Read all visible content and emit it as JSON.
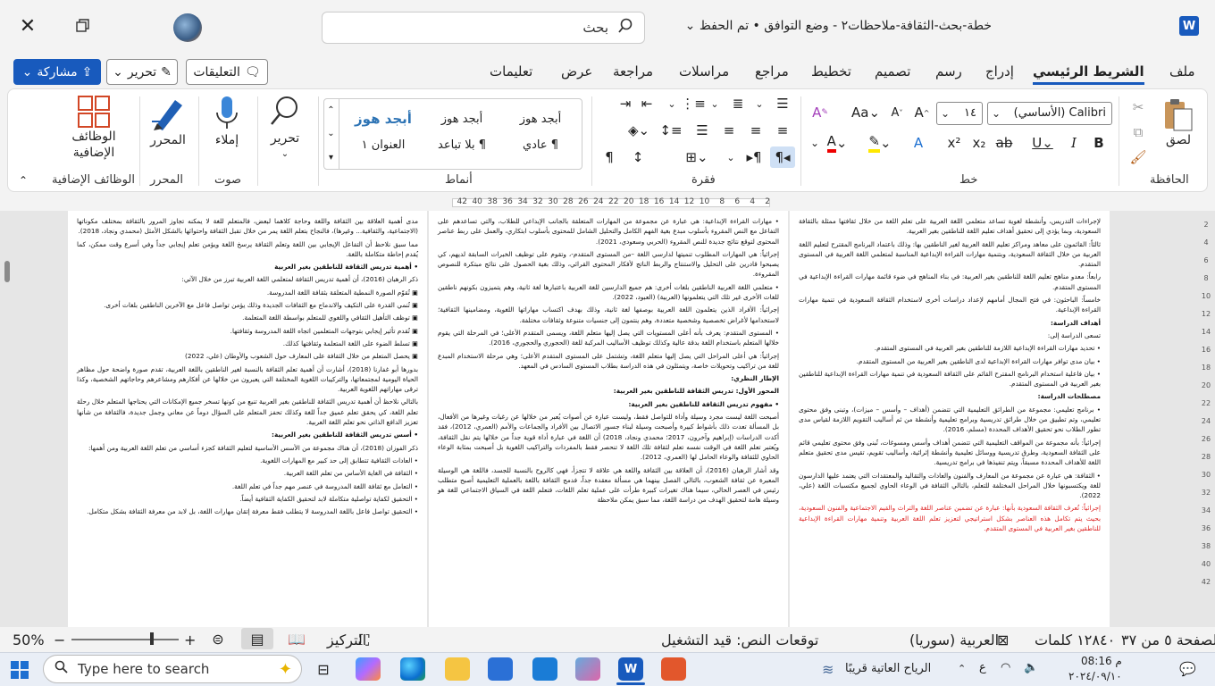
{
  "titlebar": {
    "app_icon": "word-icon",
    "doc_title": "خطة-بحث-الثقافة-ملاحظات٢ - وضع التوافق • تم الحفظ",
    "search_placeholder": "بحث"
  },
  "tabs": [
    "ملف",
    "الشريط الرئيسي",
    "إدراج",
    "رسم",
    "تصميم",
    "تخطيط",
    "مراجع",
    "مراسلات",
    "مراجعة",
    "عرض",
    "تعليمات"
  ],
  "active_tab": "الشريط الرئيسي",
  "top_buttons": {
    "comments": "التعليقات",
    "edit": "تحرير",
    "share": "مشاركة"
  },
  "ribbon": {
    "clipboard": {
      "label": "الحافظة",
      "paste": "لصق"
    },
    "font": {
      "label": "خط",
      "font_name": "Calibri (الأساسي)",
      "font_size": "١٤",
      "bold": "B",
      "italic": "I",
      "underline": "U",
      "strike": "ab",
      "sub": "x₂",
      "sup": "x²",
      "case": "Aa"
    },
    "paragraph": {
      "label": "فقرة"
    },
    "styles": {
      "label": "أنماط",
      "items": [
        {
          "sample": "أبجد هوز",
          "name": "¶ عادي"
        },
        {
          "sample": "أبجد هوز",
          "name": "¶ بلا تباعد"
        },
        {
          "sample": "أبجد هوز",
          "name": "العنوان ١"
        }
      ]
    },
    "editing": {
      "label": "تحرير"
    },
    "voice": {
      "label": "صوت",
      "dictate": "إملاء"
    },
    "editor": {
      "label": "المحرر",
      "btn": "المحرر"
    },
    "addins": {
      "label": "الوظائف الإضافية",
      "btn1": "الوظائف",
      "btn2": "الإضافية"
    }
  },
  "ruler": [
    "2",
    "4",
    "6",
    "8",
    "10",
    "12",
    "14",
    "16",
    "18",
    "20",
    "22",
    "24",
    "26",
    "28",
    "30",
    "32",
    "34",
    "36",
    "38",
    "40",
    "42"
  ],
  "pages": {
    "right": [
      {
        "t": "لإجراءات التدريس، وأنشطة لغوية تساعد متعلمي اللغة العربية على تعلم اللغة من خلال ثقافتها ممثلة بالثقافة السعودية، وبما يؤدي إلى تحقيق أهداف تعليم اللغة للناطقين بغير العربية."
      },
      {
        "t": "ثالثاً: القائمون على معاهد ومراكز تعليم اللغة العربية لغير الناطقين بها: وذلك باعتماد البرنامج المقترح لتعليم اللغة العربية من خلال الثقافة السعودية، وبتنمية مهارات القراءة الإبداعية المناسبة لمتعلمي اللغة العربية في المستوى المتقدم."
      },
      {
        "t": "رابعاً: معدو مناهج تعليم اللغة للناطقين بغير العربية: في بناء المناهج في ضوء قائمة مهارات القراءة الإبداعية في المستوى المتقدم."
      },
      {
        "t": "خامساً: الباحثون: في فتح المجال أمامهم لإعداد دراسات أخرى لاستخدام الثقافة السعودية في تنمية مهارات القراءة الإبداعية."
      },
      {
        "t": "أهداف الدراسة:",
        "h": true
      },
      {
        "t": "تسعى الدراسة إلى:"
      },
      {
        "t": "• تحديد مهارات القراءة الإبداعية اللازمة للناطقين بغير العربية في المستوى المتقدم."
      },
      {
        "t": "• بيان مدى توافر مهارات القراءة الإبداعية لدى الناطقين بغير العربية من المستوى المتقدم."
      },
      {
        "t": "• بيان فاعلية استخدام البرنامج المقترح القائم على الثقافة السعودية في تنمية مهارات القراءة الإبداعية للناطقين بغير العربية في المستوى المتقدم."
      },
      {
        "t": "مصطلحات الدراسة:",
        "h": true
      },
      {
        "t": "• برنامج تعليمي: مجموعة من الطرائق التعليمية التي تتضمن (أهداف – وأسس – ميزات)، وتبنى وفق محتوى تعليمي، وتم تطبيق من خلال طرائق تدريسية وبرامج تعليمية وأنشطة من ثم أساليب التقويم اللازمة لقياس مدى تطور الطلاب نحو تحقيق الأهداف المحددة (مسلم، 2016)."
      },
      {
        "t": "إجرائياً: بأنه مجموعة من المواقف التعليمية التي تتضمن أهداف وأسس ومسوغات، تُبنى وفق محتوى تعليمي قائم على الثقافة السعودية، وطرق تدريسية ووسائل تعليمية وأنشطة إثرائية، وأساليب تقويم، تقيس مدى تحقيق متعلم اللغة للأهداف المحددة مسبقاً، ويتم تنفيذها في برامج تدريسية."
      },
      {
        "t": "• الثقافة: هي عبارة عن مجموعة من المعارف والفنون والعادات والتقاليد والمعتقدات التي يعتمد عليها الدارسون للغة ويكتسبونها خلال المراحل المختلفة للتعلم، بالتالي الثقافة في الوعاء الحاوي لجميع مكتسبات اللغة (علي، 2022)."
      },
      {
        "t": "إجرائياً: تُعرف الثقافة السعودية بأنها: عبارة عن تضمين عناصر اللغة والتراث والقيم الاجتماعية والفنون السعودية، بحيث يتم تكامل هذه العناصر بشكل استراتيجي لتعزيز تعلم اللغة العربية وتنمية مهارات القراءة الإبداعية للناطقين بغير العربية في المستوى المتقدم.",
        "red": true
      }
    ],
    "middle": [
      {
        "t": "• مهارات القراءة الإبداعية: هي عبارة عن مجموعة من المهارات المتعلقة بالجانب الإبداعي للطلاب، والتي تساعدهم على التفاعل مع النص المقروء بأسلوب مبدع بغية الفهم الكامل والتحليل الشامل للمحتوى بأسلوب ابتكاري، والعمل على ربط عناصر المحتوى لتوقع نتائج جديدة للنص المقروء (الحربي وسعودي، 2021)."
      },
      {
        "t": "إجرائياً: هي المهارات المطلوب تنميتها لدارسي اللغة –من المستوى المتقدم-، وتقوم على توظيف الخبرات السابقة لديهم، كي يصبحوا قادرين على التحليل والاستنتاج والربط الناتج لأفكار المحتوى القرائي، وذلك بغية الحصول على نتائج مبتكرة للنصوص المقروءة."
      },
      {
        "t": "• متعلمي اللغة العربية الناطقين بلغات أخرى: هم جميع الدارسين للغة العربية باعتبارها لغة ثانية، وهم يتميزون بكونهم ناطقين للغات الأخرى غير تلك التي يتعلمونها (العربية) (العبود، 2022)."
      },
      {
        "t": "إجرائياً: الأفراد الذين يتعلمون اللغة العربية بوصفها لغة ثانية، وذلك بهدف اكتساب مهاراتها اللغوية، ومضامينها الثقافية؛ لاستخدامها لأغراض تخصصية وشخصية متعددة، وهم ينتمون إلى جنسيات متنوعة وثقافات مختلفة."
      },
      {
        "t": "• المستوى المتقدم: يعرف بأنه أعلى المستويات التي يصل إليها متعلم اللغة، ويسمى المتقدم الأعلى؛ في المرحلة التي يقوم خلالها المتعلم باستخدام اللغة بدقة عالية وكذلك توظيف الأساليب المركبة للغة (الحجوري والحجوري، 2016)."
      },
      {
        "t": "إجرائياً: هي أعلى المراحل التي يصل إليها متعلم اللغة، وتشتمل على المستوى المتقدم الأعلى؛ وهي مرحلة الاستخدام المبدع للغة من تراكيب وتحويلات خاصة، ويتمثلون في هذه الدراسة بطلاب المستوى السادس في المعهد."
      },
      {
        "t": "الإطار النظري:",
        "h": true
      },
      {
        "t": "المحور الأول: تدريس الثقافة للناطقين بغير العربية:",
        "h": true
      },
      {
        "t": "• مفهوم تدريس الثقافة للناطقين بغير العربية:",
        "h": true
      },
      {
        "t": "أصبحت اللغة ليست مجرد وسيلة وأداة للتواصل فقط، وليست عبارة عن أصوات يُعبر من خلالها عن رغبات وغيرها من الأفعال، بل المسألة تعدت ذلك بأشواط كبيرة وأصبحت وسيلة لبناء جسور الاتصال بين الأفراد والجماعات والأمم (العمري، 2012)، فقد أكدت الدراسات (إبراهيم وآخرون، 2017؛ محمدي ونجاد، 2018) أن اللغة في عبارة أداة قوية جداً من خلالها يتم نقل الثقافة، ويُعتبر تعلم اللغة في الوقت نفسه تعلم لثقافة تلك اللغة لا تنحصر فقط بالمفردات والتراكيب اللغوية بل أصبحت بمثابة الوعاء الحاوي للثقافة والوعاء الحامل لها (العمري، 2012)."
      },
      {
        "t": "وقد أشار الرهبان (2016)، أن العلاقة بين الثقافة واللغة هي علاقة لا تتجزأ، فهي كالروح بالنسبة للجسد، فاللغة هي الوسيلة المعبرة عن ثقافة الشعوب، بالتالي الفصل بينهما هي مسألة معقدة جداً، فدمج الثقافة باللغة بالعملية التعليمية أصبح متطلب رئيس في العصر الحالي، سيما هناك تغيرات كبيرة طرأت على عملية تعلم اللغات، فتعلم اللغة في السياق الاجتماعي للغة هو وسيلة هامة لتحقيق الهدف من دراسة اللغة، مما سبق يمكن ملاحظة"
      }
    ],
    "left": [
      {
        "t": "مدى أهمية العلاقة بين الثقافة واللغة وحاجة كلاهما لبعض، فالمتعلم للغة لا يمكنه تجاوز المرور بالثقافة بمختلف مكوناتها (الاجتماعية، والثقافية... وغيرها)، فالنجاح بتعلم اللغة يمر من خلال تقبل الثقافة واحتوائها بالشكل الأمثل (محمدي ونجاد، 2018)."
      },
      {
        "t": "مما سبق نلاحظ أن التفاعل الإيجابي بين اللغة وتعلم الثقافة يرسخ اللغة ويؤمن تعلم إيجابي جداً وفي أسرع وقت ممكن، كما يُقدم إحاطة متكاملة باللغة."
      },
      {
        "t": "• أهمية تدريس الثقافة للناطقين بغير العربية",
        "h": true
      },
      {
        "t": "ذكر الرهبان (2016)، أن أهمية تدريس الثقافة لمتعلمي اللغة العربية تبرز من خلال الآتي:"
      },
      {
        "t": "▣ تُقوّم الصورة النمطية المتعلقة بثقافة اللغة المدروسة."
      },
      {
        "t": "▣ تُنمي القدرة على التكيف والاندماج مع الثقافات الجديدة وذلك يؤمن تواصل فاعل مع الآخرين الناطقين بلغات أخرى."
      },
      {
        "t": "▣ توظف التأهيل الثقافي واللغوي للمتعلم بواسطة اللغة المتعلمة."
      },
      {
        "t": "▣ تُقدم تأثير إيجابي بتوجهات المتعلمين اتجاه اللغة المدروسة وثقافتها."
      },
      {
        "t": "▣ تسلط الضوء على اللغة المتعلمة وثقافتها كذلك."
      },
      {
        "t": "▣ يحصل المتعلم من خلال الثقافة على المعارف حول الشعوب والأوطان (علي، 2022)"
      },
      {
        "t": "بدورها أبو غفارنا (2018)، أشارت أن أهمية تعلم الثقافة بالنسبة لغير الناطقين باللغة العربية، تقدم صورة واضحة حول مظاهر الحياة اليومية لمجتمعاتها، والتركيبات اللغوية المختلفة التي يعبرون من خلالها عن أفكارهم ومشاعرهم وحاجاتهم الشخصية، وكذا ترقى مهاراتهم اللغوية العربية."
      },
      {
        "t": "بالتالي نلاحظ أن أهمية تدريس الثقافة للناطقين بغير العربية تنبع من كونها تسخر جميع الإمكانات التي يحتاجها المتعلم خلال رحلة تعلم اللغة، كي يحقق تعلم عميق جداً للغة وكذلك تحفز المتعلم على السؤال دوماً عن معاني وجمل جديدة، فالثقافة من شأنها تعزيز الدافع الذاتي نحو تعلم اللغة العربية."
      },
      {
        "t": "• أسس تدريس الثقافة للناطقين بغير العربية:",
        "h": true
      },
      {
        "t": "ذكر الفوزان (2018)، أن هناك مجموعة من الأسس الأساسية لتعليم الثقافة كجزء أساسي من تعلم اللغة العربية ومن أهمها:"
      },
      {
        "t": "• العادات الثقافية تتطابق إلى حد كبير مع المهارات اللغوية."
      },
      {
        "t": "• الثقافة في الغاية الأساس من تعلم اللغة العربية."
      },
      {
        "t": "• التعامل مع ثقافة اللغة المدروسة في عنصر مهم جداً في تعلم اللغة."
      },
      {
        "t": "• التحقيق لكفاية تواصلية متكاملة لابد لتحقيق الكفاية الثقافية أيضاً."
      },
      {
        "t": "• التحقيق تواصل فاعل باللغة المدروسة لا يتطلب فقط معرفة إتقان مهارات اللغة، بل لابد من معرفة الثقافة بشكل متكامل."
      }
    ]
  },
  "status": {
    "page": "الصفحة ٥ من ٣٧",
    "words": "١٢٨٤٠ كلمات",
    "lang": "العربية (سوريا)",
    "predict": "توقعات النص: قيد التشغيل",
    "focus": "التركيز",
    "zoom": "50%"
  },
  "taskbar": {
    "search_placeholder": "Type here to search",
    "weather": "الرياح العاتية قريبًا",
    "time": "08:16 م",
    "date": "٢٠٢٤/٠٩/١٠",
    "lang": "ع"
  }
}
